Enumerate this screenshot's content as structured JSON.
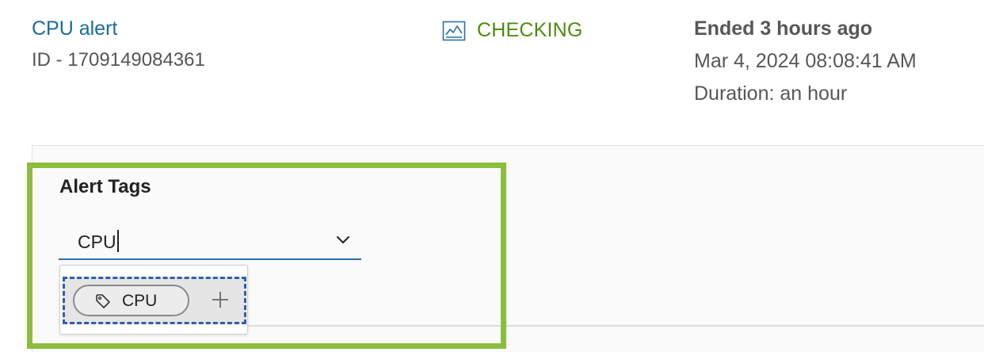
{
  "alert": {
    "name": "CPU alert",
    "id_text": "ID - 1709149084361"
  },
  "status": {
    "icon": "line-chart-icon",
    "text": "CHECKING",
    "color": "#4f8a10"
  },
  "timing": {
    "ended": "Ended 3 hours ago",
    "date": "Mar 4, 2024 08:08:41 AM",
    "duration": "Duration: an hour"
  },
  "tags": {
    "label": "Alert Tags",
    "input_value": "CPU",
    "dropdown": {
      "options": [
        {
          "label": "CPU",
          "icon": "tag-icon",
          "action_icon": "plus-icon"
        }
      ]
    }
  },
  "colors": {
    "link": "#1a6aa3",
    "highlight": "#8bbd3f",
    "focus": "#2f5fa8"
  }
}
